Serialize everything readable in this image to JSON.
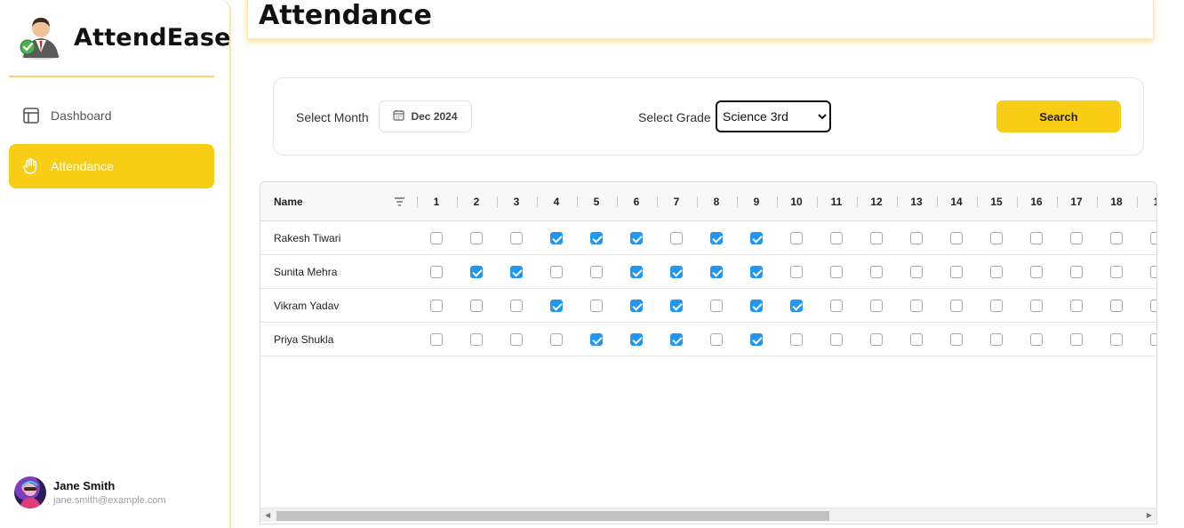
{
  "app": {
    "name": "AttendEase"
  },
  "sidebar": {
    "items": [
      {
        "label": "Dashboard",
        "icon": "layout-icon",
        "active": false
      },
      {
        "label": "Attendance",
        "icon": "hand-icon",
        "active": true
      }
    ],
    "user": {
      "name": "Jane Smith",
      "email": "jane.smith@example.com"
    }
  },
  "header": {
    "title": "Attendance"
  },
  "filters": {
    "month_label": "Select Month",
    "month_value": "Dec 2024",
    "grade_label": "Select Grade",
    "grade_value": "Science 3rd",
    "search_label": "Search"
  },
  "grid": {
    "name_header": "Name",
    "days": [
      "1",
      "2",
      "3",
      "4",
      "5",
      "6",
      "7",
      "8",
      "9",
      "10",
      "11",
      "12",
      "13",
      "14",
      "15",
      "16",
      "17",
      "18",
      "1"
    ],
    "rows": [
      {
        "name": "Rakesh Tiwari",
        "present": [
          4,
          5,
          6,
          8,
          9
        ]
      },
      {
        "name": "Sunita Mehra",
        "present": [
          2,
          3,
          6,
          7,
          8,
          9
        ]
      },
      {
        "name": "Vikram Yadav",
        "present": [
          4,
          6,
          7,
          9,
          10
        ]
      },
      {
        "name": "Priya Shukla",
        "present": [
          5,
          6,
          7,
          9
        ]
      }
    ]
  },
  "colors": {
    "accent": "#f9cd15",
    "check": "#2196f3"
  }
}
